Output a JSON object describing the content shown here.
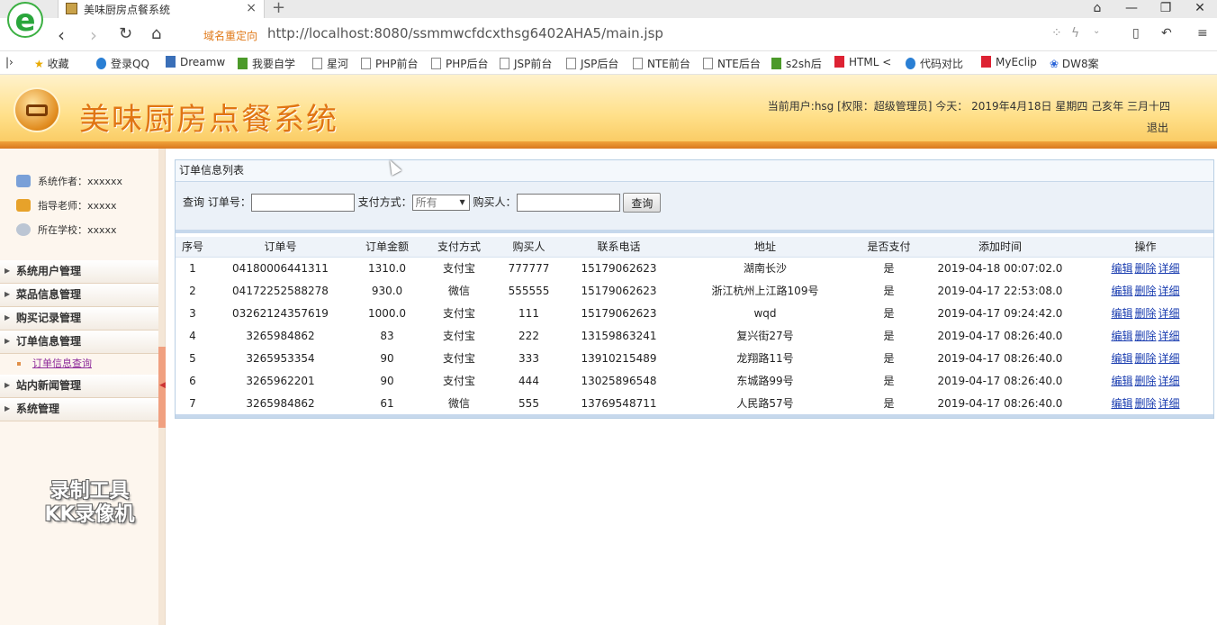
{
  "browser": {
    "tab_title": "美味厨房点餐系统",
    "tab_close": "×",
    "new_tab": "+",
    "redirect_label": "域名重定向",
    "url": "http://localhost:8080/ssmmwcfdcxthsg6402AHA5/main.jsp",
    "window_buttons": [
      "⌂",
      "—",
      "❐",
      "✕"
    ],
    "bookmarks": [
      "收藏",
      "登录QQ",
      "Dreamw",
      "我要自学",
      "星河",
      "PHP前台",
      "PHP后台",
      "JSP前台",
      "JSP后台",
      "NTE前台",
      "NTE后台",
      "s2sh后",
      "HTML <",
      "代码对比",
      "MyEclip",
      "DW8案"
    ]
  },
  "header": {
    "title": "美味厨房点餐系统",
    "user_info": "当前用户:hsg [权限：超级管理员] 今天： 2019年4月18日 星期四 己亥年 三月十四",
    "logout": "退出"
  },
  "sidebar": {
    "info": [
      "系统作者：xxxxxx",
      "指导老师：xxxxx",
      "所在学校：xxxxx"
    ],
    "menu": [
      "系统用户管理",
      "菜品信息管理",
      "购买记录管理",
      "订单信息管理",
      "站内新闻管理",
      "系统管理"
    ],
    "submenu_item": "订单信息查询",
    "watermark_line1": "录制工具",
    "watermark_line2": "KK录像机"
  },
  "panel": {
    "title": "订单信息列表",
    "search": {
      "prefix": "查询 订单号：",
      "pay_label": "支付方式：",
      "pay_selected": "所有",
      "buyer_label": "购买人：",
      "button": "查询"
    }
  },
  "table": {
    "headers": [
      "序号",
      "订单号",
      "订单金额",
      "支付方式",
      "购买人",
      "联系电话",
      "地址",
      "是否支付",
      "添加时间",
      "操作"
    ],
    "actions": [
      "编辑",
      "删除",
      "详细"
    ],
    "rows": [
      [
        "1",
        "04180006441311",
        "1310.0",
        "支付宝",
        "777777",
        "15179062623",
        "湖南长沙",
        "是",
        "2019-04-18 00:07:02.0"
      ],
      [
        "2",
        "04172252588278",
        "930.0",
        "微信",
        "555555",
        "15179062623",
        "浙江杭州上江路109号",
        "是",
        "2019-04-17 22:53:08.0"
      ],
      [
        "3",
        "03262124357619",
        "1000.0",
        "支付宝",
        "111",
        "15179062623",
        "wqd",
        "是",
        "2019-04-17 09:24:42.0"
      ],
      [
        "4",
        "3265984862",
        "83",
        "支付宝",
        "222",
        "13159863241",
        "复兴街27号",
        "是",
        "2019-04-17 08:26:40.0"
      ],
      [
        "5",
        "3265953354",
        "90",
        "支付宝",
        "333",
        "13910215489",
        "龙翔路11号",
        "是",
        "2019-04-17 08:26:40.0"
      ],
      [
        "6",
        "3265962201",
        "90",
        "支付宝",
        "444",
        "13025896548",
        "东城路99号",
        "是",
        "2019-04-17 08:26:40.0"
      ],
      [
        "7",
        "3265984862",
        "61",
        "微信",
        "555",
        "13769548711",
        "人民路57号",
        "是",
        "2019-04-17 08:26:40.0"
      ]
    ]
  }
}
